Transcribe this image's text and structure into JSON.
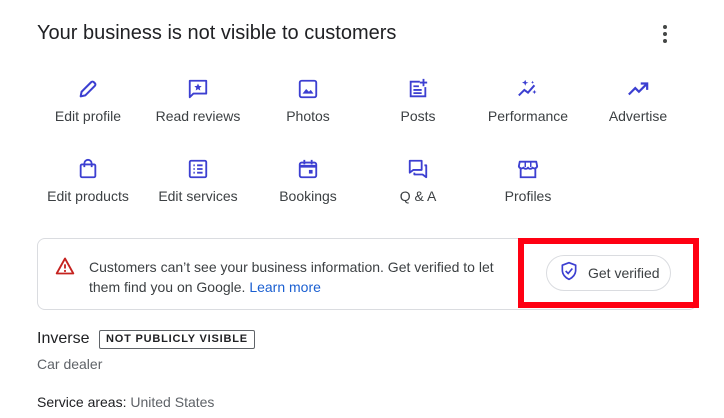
{
  "header": {
    "title": "Your business is not visible to customers",
    "more_icon": "more-vert-icon"
  },
  "actions_row1": [
    {
      "label": "Edit profile",
      "icon": "pencil-icon"
    },
    {
      "label": "Read reviews",
      "icon": "review-star-icon"
    },
    {
      "label": "Photos",
      "icon": "image-icon"
    },
    {
      "label": "Posts",
      "icon": "post-add-icon"
    },
    {
      "label": "Performance",
      "icon": "sparkle-trend-icon"
    },
    {
      "label": "Advertise",
      "icon": "trending-up-icon"
    }
  ],
  "actions_row2": [
    {
      "label": "Edit products",
      "icon": "shopping-bag-icon"
    },
    {
      "label": "Edit services",
      "icon": "list-icon"
    },
    {
      "label": "Bookings",
      "icon": "calendar-icon"
    },
    {
      "label": "Q & A",
      "icon": "chat-bubbles-icon"
    },
    {
      "label": "Profiles",
      "icon": "storefront-icon"
    }
  ],
  "alert": {
    "icon": "warning-triangle-icon",
    "message": "Customers can’t see your business information. Get verified to let them find you on Google.",
    "link": "Learn more",
    "button_label": "Get verified",
    "button_icon": "verified-shield-icon"
  },
  "business": {
    "name": "Inverse",
    "badge": "NOT PUBLICLY VISIBLE",
    "category": "Car dealer",
    "service_label": "Service areas:",
    "service_value": "United States"
  },
  "colors": {
    "icon": "#3c3fd1",
    "warning": "#c5221f",
    "link": "#1a5fd1",
    "highlight": "#ff0012"
  }
}
